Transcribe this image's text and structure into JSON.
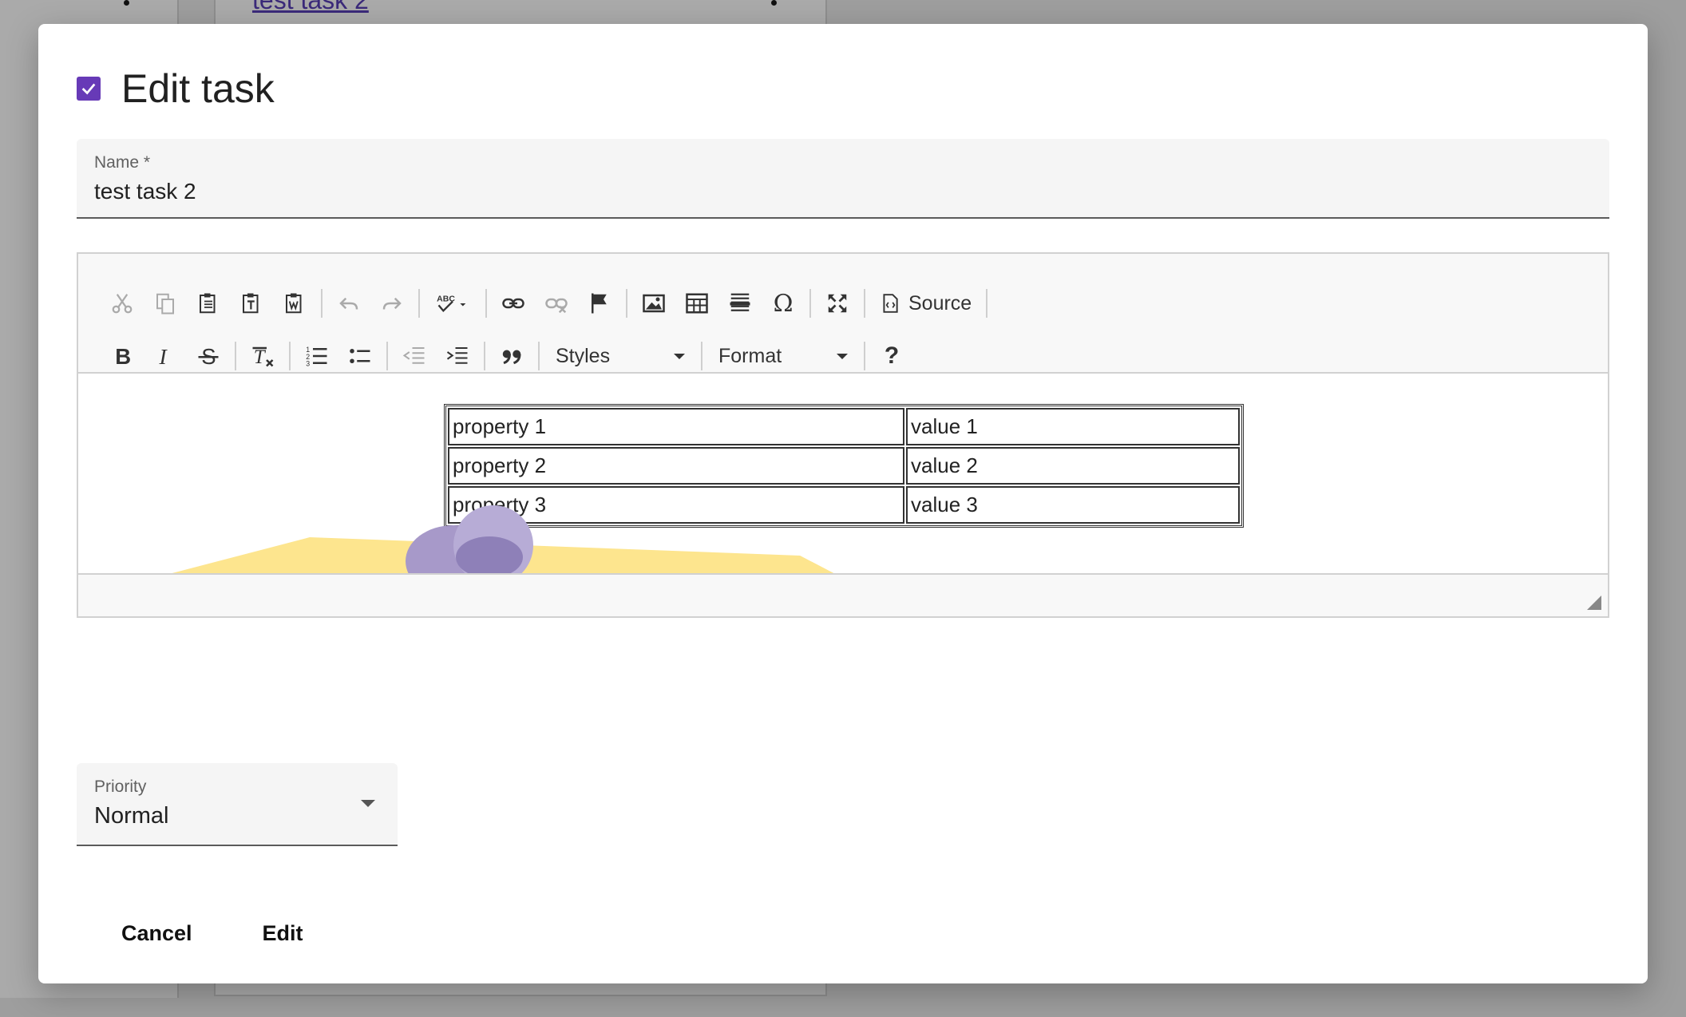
{
  "background": {
    "link_text": "test task 2"
  },
  "dialog": {
    "title": "Edit task",
    "checkbox_checked": true,
    "accent_color": "#673ab7",
    "name_field": {
      "label": "Name *",
      "value": "test task 2"
    },
    "editor": {
      "toolbar_row1": [
        "cut-icon",
        "copy-icon",
        "paste-icon",
        "paste-text-icon",
        "paste-word-icon",
        "undo-icon",
        "redo-icon",
        "spellcheck-icon",
        "link-icon",
        "unlink-icon",
        "anchor-flag-icon",
        "image-icon",
        "table-icon",
        "horizontal-line-icon",
        "special-char-omega-icon",
        "maximize-icon",
        "source-icon"
      ],
      "source_label": "Source",
      "omega_glyph": "Ω",
      "help_glyph": "?",
      "styles_label": "Styles",
      "format_label": "Format",
      "table": [
        [
          "property 1",
          "value 1"
        ],
        [
          "property 2",
          "value 2"
        ],
        [
          "property 3",
          "value 3"
        ]
      ]
    },
    "priority": {
      "label": "Priority",
      "value": "Normal"
    },
    "buttons": {
      "cancel": "Cancel",
      "edit": "Edit"
    }
  }
}
